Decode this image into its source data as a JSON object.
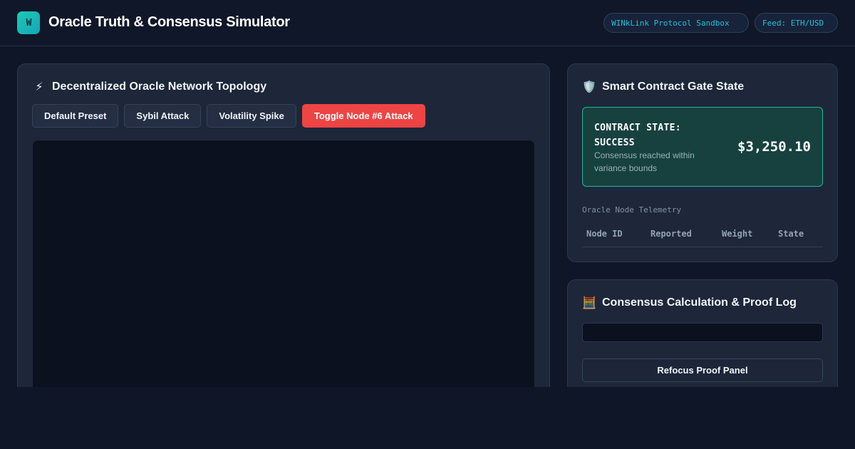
{
  "header": {
    "logo_text": "W",
    "title": "Oracle Truth & Consensus Simulator",
    "badges": {
      "sandbox": "WINkLink Protocol Sandbox",
      "feed": "Feed: ETH/USD"
    }
  },
  "topology": {
    "icon": "lightning-icon",
    "icon_glyph": "⚡",
    "title": "Decentralized Oracle Network Topology",
    "buttons": {
      "default_preset": "Default Preset",
      "sybil_attack": "Sybil Attack",
      "volatility_spike": "Volatility Spike",
      "toggle_node": "Toggle Node #6 Attack"
    }
  },
  "gate": {
    "icon": "shield-icon",
    "icon_glyph": "🛡️",
    "title": "Smart Contract Gate State",
    "state_heading": "CONTRACT STATE: SUCCESS",
    "state_description": "Consensus reached within variance bounds",
    "price": "$3,250.10",
    "telemetry_label": "Oracle Node Telemetry",
    "columns": [
      "Node ID",
      "Reported",
      "Weight",
      "State"
    ]
  },
  "log": {
    "icon": "abacus-icon",
    "icon_glyph": "🧮",
    "title": "Consensus Calculation & Proof Log",
    "refocus_label": "Refocus Proof Panel"
  },
  "colors": {
    "background": "#0e1627",
    "panel": "#1d2739",
    "accent_teal": "#1ec9b4",
    "badge_text": "#22c3d9",
    "danger": "#ef4444",
    "success_card": "#17413f",
    "success_border": "#23b59a"
  }
}
